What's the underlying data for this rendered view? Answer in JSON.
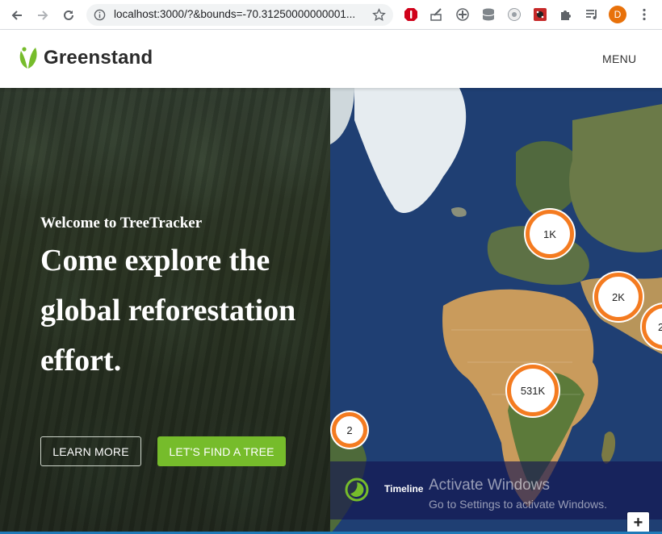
{
  "browser": {
    "url": "localhost:3000/?&bounds=-70.31250000000001...",
    "avatar_initial": "D",
    "extension_icons": [
      "adblock-icon",
      "paint-icon",
      "game-controller-icon",
      "database-icon",
      "browser-icon",
      "ladybug-icon",
      "puzzle-icon",
      "media-control-icon"
    ]
  },
  "header": {
    "brand": "Greenstand",
    "menu_label": "MENU"
  },
  "hero": {
    "welcome": "Welcome to TreeTracker",
    "headline": "Come explore the global reforestation effort.",
    "learn_more_label": "LEARN MORE",
    "find_tree_label": "LET'S FIND A TREE"
  },
  "map": {
    "clusters": [
      {
        "label": "1K"
      },
      {
        "label": "2K"
      },
      {
        "label": "2"
      },
      {
        "label": "531K"
      },
      {
        "label": "2"
      }
    ],
    "timeline_label": "Timeline",
    "zoom_in_label": "+"
  },
  "watermark": {
    "title": "Activate Windows",
    "subtitle": "Go to Settings to activate Windows."
  },
  "colors": {
    "brand_green": "#76bc2b",
    "cluster_orange": "#f47b20",
    "avatar_orange": "#e8710a"
  }
}
